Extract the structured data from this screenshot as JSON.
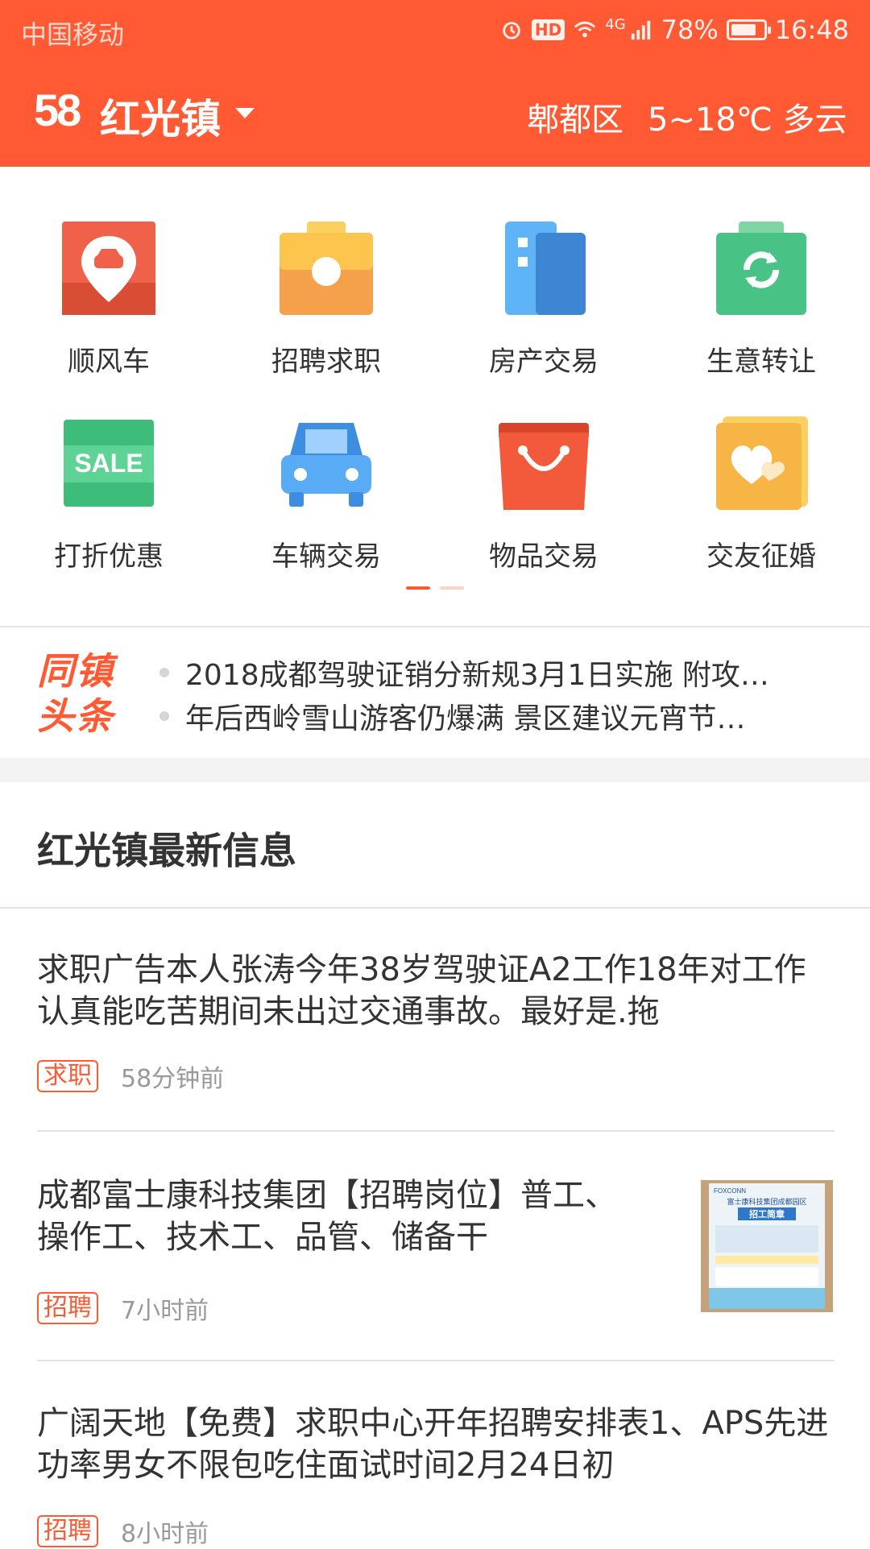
{
  "status_bar": {
    "carrier": "中国移动",
    "hd": "HD",
    "network": "4G",
    "battery": "78%",
    "battery_level": 0.78,
    "time": "16:48"
  },
  "header": {
    "logo": "58",
    "town": "红光镇",
    "district": "郫都区",
    "weather": "5~18℃ 多云",
    "color": "#ff5a33"
  },
  "categories": [
    {
      "label": "顺风车",
      "icon": "carpool-pin-icon"
    },
    {
      "label": "招聘求职",
      "icon": "briefcase-icon"
    },
    {
      "label": "房产交易",
      "icon": "building-icon"
    },
    {
      "label": "生意转让",
      "icon": "transfer-bag-icon"
    },
    {
      "label": "打折优惠",
      "icon": "sale-tag-icon",
      "icon_text": "SALE"
    },
    {
      "label": "车辆交易",
      "icon": "car-icon"
    },
    {
      "label": "物品交易",
      "icon": "shopping-bag-icon"
    },
    {
      "label": "交友征婚",
      "icon": "heart-icon"
    }
  ],
  "pager": {
    "pages": 2,
    "active": 0
  },
  "headlines": {
    "brand_line1": "同镇",
    "brand_line2": "头条",
    "items": [
      "2018成都驾驶证销分新规3月1日实施 附攻…",
      "年后西岭雪山游客仍爆满 景区建议元宵节…"
    ]
  },
  "section": {
    "title": "红光镇最新信息"
  },
  "listings": [
    {
      "title": "求职广告本人张涛今年38岁驾驶证A2工作18年对工作认真能吃苦期间未出过交通事故。最好是.拖",
      "tag": "求职",
      "time": "58分钟前",
      "thumbnail": false
    },
    {
      "title": "成都富士康科技集团【招聘岗位】普工、操作工、技术工、品管、储备干",
      "tag": "招聘",
      "time": "7小时前",
      "thumbnail": true,
      "thumb_text": {
        "brand": "FOXCONN",
        "org": "富士康科技集团成都园区",
        "heading": "招工简章"
      }
    },
    {
      "title": "广阔天地【免费】求职中心开年招聘安排表1、APS先进功率男女不限包吃住面试时间2月24日初",
      "tag": "招聘",
      "time": "8小时前",
      "thumbnail": false
    }
  ]
}
